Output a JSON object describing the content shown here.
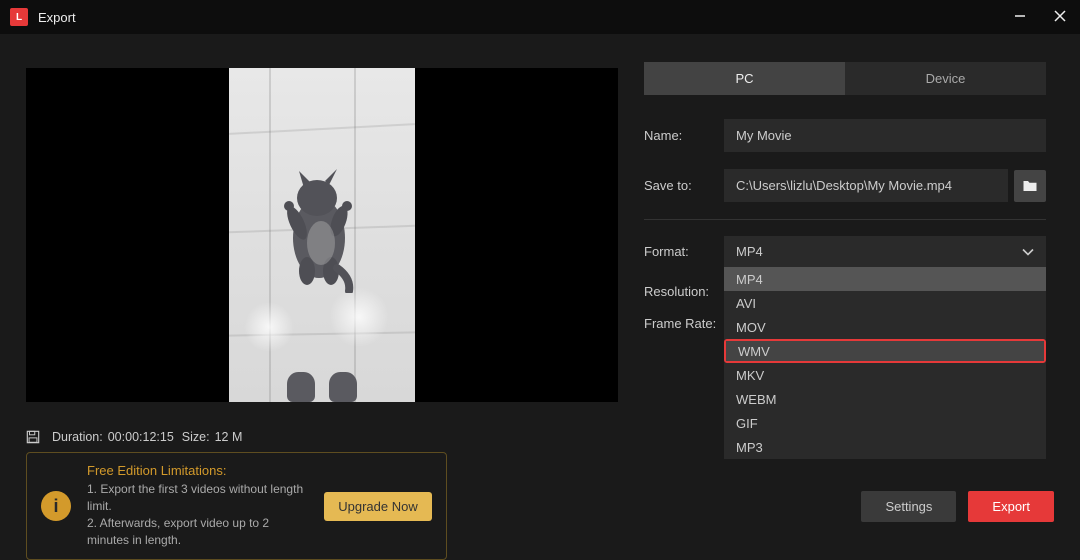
{
  "window": {
    "title": "Export"
  },
  "tabs": {
    "pc": "PC",
    "device": "Device"
  },
  "fields": {
    "name_label": "Name:",
    "name_value": "My Movie",
    "saveto_label": "Save to:",
    "saveto_value": "C:\\Users\\lizlu\\Desktop\\My Movie.mp4",
    "format_label": "Format:",
    "format_value": "MP4",
    "resolution_label": "Resolution:",
    "framerate_label": "Frame Rate:",
    "format_options": [
      "MP4",
      "AVI",
      "MOV",
      "WMV",
      "MKV",
      "WEBM",
      "GIF",
      "MP3"
    ]
  },
  "meta": {
    "duration_label": "Duration:",
    "duration_value": "00:00:12:15",
    "size_label": "Size:",
    "size_value": "12 M"
  },
  "warning": {
    "title": "Free Edition Limitations:",
    "line1": "1. Export the first 3 videos without length limit.",
    "line2": "2. Afterwards, export video up to 2 minutes in length.",
    "upgrade": "Upgrade Now"
  },
  "buttons": {
    "settings": "Settings",
    "export": "Export"
  }
}
